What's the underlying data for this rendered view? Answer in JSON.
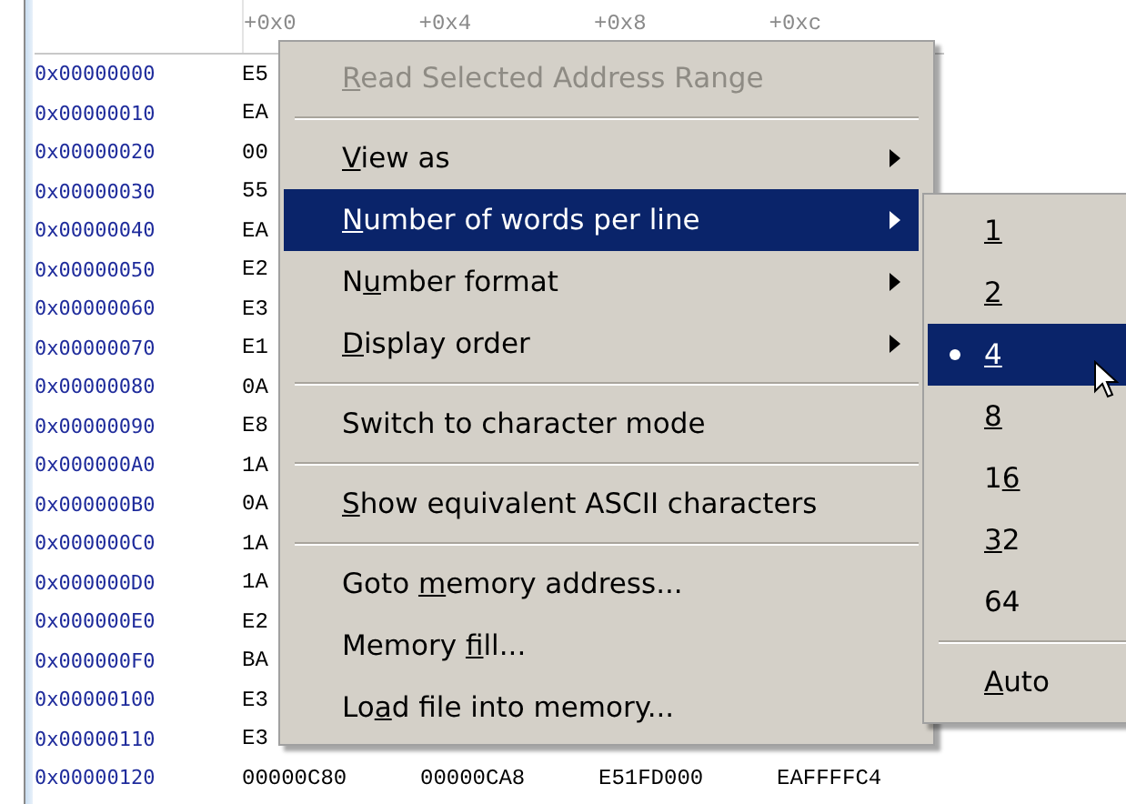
{
  "memory_view": {
    "headers": [
      "+0x0",
      "+0x4",
      "+0x8",
      "+0xc"
    ],
    "rows": [
      {
        "address": "0x00000000",
        "values": [
          "E5"
        ]
      },
      {
        "address": "0x00000010",
        "values": [
          "EA"
        ]
      },
      {
        "address": "0x00000020",
        "values": [
          "00"
        ]
      },
      {
        "address": "0x00000030",
        "values": [
          "55"
        ]
      },
      {
        "address": "0x00000040",
        "values": [
          "EA"
        ]
      },
      {
        "address": "0x00000050",
        "values": [
          "E2"
        ]
      },
      {
        "address": "0x00000060",
        "values": [
          "E3"
        ]
      },
      {
        "address": "0x00000070",
        "values": [
          "E1"
        ]
      },
      {
        "address": "0x00000080",
        "values": [
          "0A"
        ]
      },
      {
        "address": "0x00000090",
        "values": [
          "E8"
        ]
      },
      {
        "address": "0x000000A0",
        "values": [
          "1A"
        ]
      },
      {
        "address": "0x000000B0",
        "values": [
          "0A"
        ]
      },
      {
        "address": "0x000000C0",
        "values": [
          "1A"
        ]
      },
      {
        "address": "0x000000D0",
        "values": [
          "1A"
        ]
      },
      {
        "address": "0x000000E0",
        "values": [
          "E2"
        ]
      },
      {
        "address": "0x000000F0",
        "values": [
          "BA"
        ]
      },
      {
        "address": "0x00000100",
        "values": [
          "E3"
        ]
      },
      {
        "address": "0x00000110",
        "values": [
          "E3"
        ]
      },
      {
        "address": "0x00000120",
        "values": [
          "00000C80",
          "00000CA8",
          "E51FD000",
          "EAFFFFC4"
        ]
      }
    ]
  },
  "context_menu": {
    "items": [
      {
        "kind": "item",
        "label": {
          "key": "R",
          "after": "ead Selected Address Range"
        },
        "disabled": true,
        "highlighted": false,
        "submenu": false
      },
      {
        "kind": "separator"
      },
      {
        "kind": "item",
        "label": {
          "key": "V",
          "after": "iew as"
        },
        "disabled": false,
        "highlighted": false,
        "submenu": true
      },
      {
        "kind": "item",
        "label": {
          "key": "N",
          "after": "umber of words per line"
        },
        "disabled": false,
        "highlighted": true,
        "submenu": true
      },
      {
        "kind": "item",
        "label": {
          "before": "N",
          "key": "u",
          "after": "mber format"
        },
        "disabled": false,
        "highlighted": false,
        "submenu": true
      },
      {
        "kind": "item",
        "label": {
          "key": "D",
          "after": "isplay order"
        },
        "disabled": false,
        "highlighted": false,
        "submenu": true
      },
      {
        "kind": "separator"
      },
      {
        "kind": "item",
        "label": {
          "before": "Switch to character mode"
        },
        "disabled": false,
        "highlighted": false,
        "submenu": false
      },
      {
        "kind": "separator"
      },
      {
        "kind": "item",
        "label": {
          "key": "S",
          "after": "how equivalent ASCII characters"
        },
        "disabled": false,
        "highlighted": false,
        "submenu": false
      },
      {
        "kind": "separator"
      },
      {
        "kind": "item",
        "label": {
          "before": "Goto ",
          "key": "m",
          "after": "emory address..."
        },
        "disabled": false,
        "highlighted": false,
        "submenu": false
      },
      {
        "kind": "item",
        "label": {
          "before": "Memory ",
          "key": "f",
          "after": "ill..."
        },
        "disabled": false,
        "highlighted": false,
        "submenu": false
      },
      {
        "kind": "item",
        "label": {
          "before": "Lo",
          "key": "a",
          "after": "d file into memory..."
        },
        "disabled": false,
        "highlighted": false,
        "submenu": false
      }
    ]
  },
  "submenu": {
    "items": [
      {
        "kind": "item",
        "label": {
          "key": "1"
        },
        "selected": false,
        "highlighted": false
      },
      {
        "kind": "item",
        "label": {
          "key": "2"
        },
        "selected": false,
        "highlighted": false
      },
      {
        "kind": "item",
        "label": {
          "key": "4"
        },
        "selected": true,
        "highlighted": true
      },
      {
        "kind": "item",
        "label": {
          "key": "8"
        },
        "selected": false,
        "highlighted": false
      },
      {
        "kind": "item",
        "label": {
          "before": "1",
          "key": "6"
        },
        "selected": false,
        "highlighted": false
      },
      {
        "kind": "item",
        "label": {
          "key": "3",
          "after": "2"
        },
        "selected": false,
        "highlighted": false
      },
      {
        "kind": "item",
        "label": {
          "before": "64"
        },
        "selected": false,
        "highlighted": false
      },
      {
        "kind": "separator"
      },
      {
        "kind": "item",
        "label": {
          "key": "A",
          "after": "uto"
        },
        "selected": false,
        "highlighted": false
      }
    ]
  }
}
